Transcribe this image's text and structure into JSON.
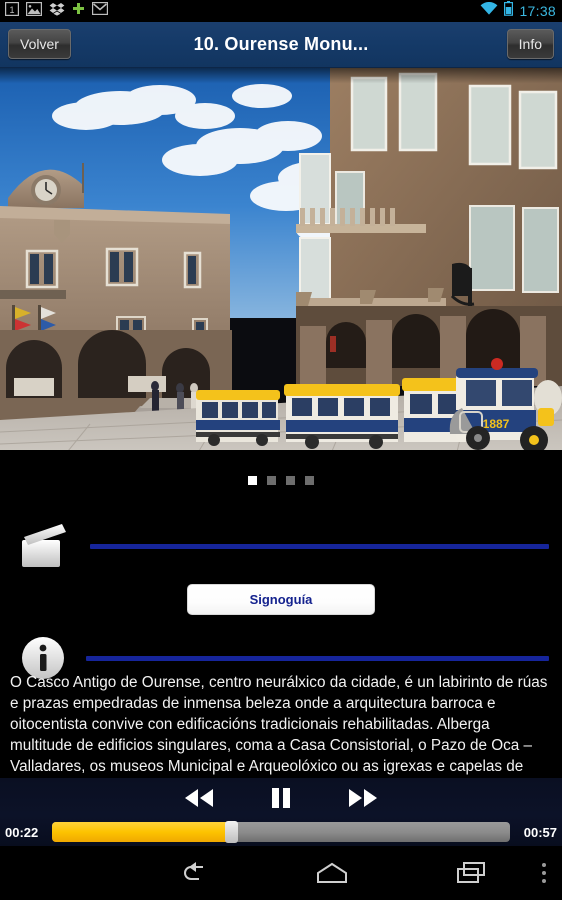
{
  "statusbar": {
    "time": "17:38",
    "icons": [
      "screenshot-icon",
      "gallery-icon",
      "dropbox-icon",
      "plus-icon",
      "gmail-icon"
    ],
    "right_icons": [
      "wifi-icon",
      "battery-icon"
    ],
    "accent_color": "#33B5E5"
  },
  "titlebar": {
    "back_label": "Volver",
    "title": "10. Ourense Monu...",
    "info_label": "Info",
    "background_color": "#15396a"
  },
  "photo": {
    "alt": "Praza Maior de Ourense with Casa Consistorial and tourist train",
    "train_number": "1887"
  },
  "carousel": {
    "total": 4,
    "active_index": 0
  },
  "sections": {
    "video": {
      "icon": "film-clapper-icon",
      "rule_color": "#16259b"
    },
    "info": {
      "icon": "info-circle-icon",
      "rule_color": "#16259b"
    }
  },
  "signoguia": {
    "label": "Signoguía",
    "text_color": "#14228e"
  },
  "description": {
    "text": "O Casco Antigo de Ourense, centro neurálxico da cidade, é un labirinto de rúas e prazas empedradas de inmensa beleza onde a arquitectura barroca e oitocentista convive con edificacións tradicionais rehabilitadas. Alberga multitude de edificios singulares, coma a Casa Consistorial, o Pazo de Oca – Valladares, os museos Municipal e Arqueolóxico ou as igrexas e capelas de Santa María Madre, San Francisco, San Domingos, San Francisco, Trinidade, etc."
  },
  "player": {
    "rewind_label": "rewind-button",
    "pause_label": "pause-button",
    "forward_label": "forward-button",
    "elapsed": "00:22",
    "duration": "00:57",
    "progress_percent": 39,
    "fill_color": "#fdc300"
  },
  "androidnav": {
    "back": "back-nav-icon",
    "home": "home-nav-icon",
    "recents": "recents-nav-icon",
    "overflow": "overflow-menu-icon"
  }
}
